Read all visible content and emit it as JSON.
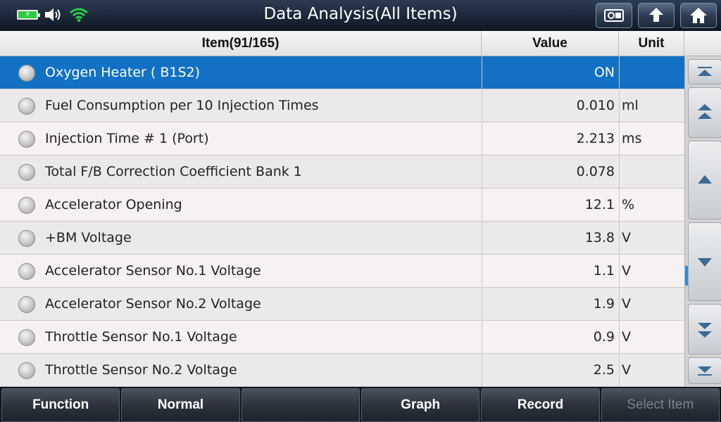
{
  "header": {
    "title": "Data Analysis(All Items)"
  },
  "table": {
    "columns": {
      "item": "Item(91/165)",
      "value": "Value",
      "unit": "Unit"
    },
    "rows": [
      {
        "name": "Oxygen Heater ( B1S2)",
        "value": "ON",
        "unit": ""
      },
      {
        "name": "Fuel Consumption per 10 Injection Times",
        "value": "0.010",
        "unit": "ml"
      },
      {
        "name": "Injection Time # 1 (Port)",
        "value": "2.213",
        "unit": "ms"
      },
      {
        "name": "Total F/B Correction Coefficient Bank 1",
        "value": "0.078",
        "unit": ""
      },
      {
        "name": "Accelerator Opening",
        "value": "12.1",
        "unit": "%"
      },
      {
        "name": "+BM Voltage",
        "value": "13.8",
        "unit": "V"
      },
      {
        "name": "Accelerator Sensor No.1 Voltage",
        "value": "1.1",
        "unit": "V"
      },
      {
        "name": "Accelerator Sensor No.2 Voltage",
        "value": "1.9",
        "unit": "V"
      },
      {
        "name": "Throttle Sensor No.1 Voltage",
        "value": "0.9",
        "unit": "V"
      },
      {
        "name": "Throttle Sensor No.2 Voltage",
        "value": "2.5",
        "unit": "V"
      }
    ]
  },
  "toolbar": {
    "function_label": "Function",
    "normal_label": "Normal",
    "empty_label": "",
    "graph_label": "Graph",
    "record_label": "Record",
    "select_item_label": "Select Item"
  },
  "colors": {
    "selected_row": "#1271c4",
    "title_bar": "#1b2738",
    "battery": "#2ecc40",
    "wifi": "#22d14a"
  },
  "icons": {
    "battery": "battery-charging-icon",
    "volume": "speaker-icon",
    "wifi": "wifi-icon",
    "screenshot": "screenshot-icon",
    "back": "back-arrow-icon",
    "home": "home-icon"
  }
}
